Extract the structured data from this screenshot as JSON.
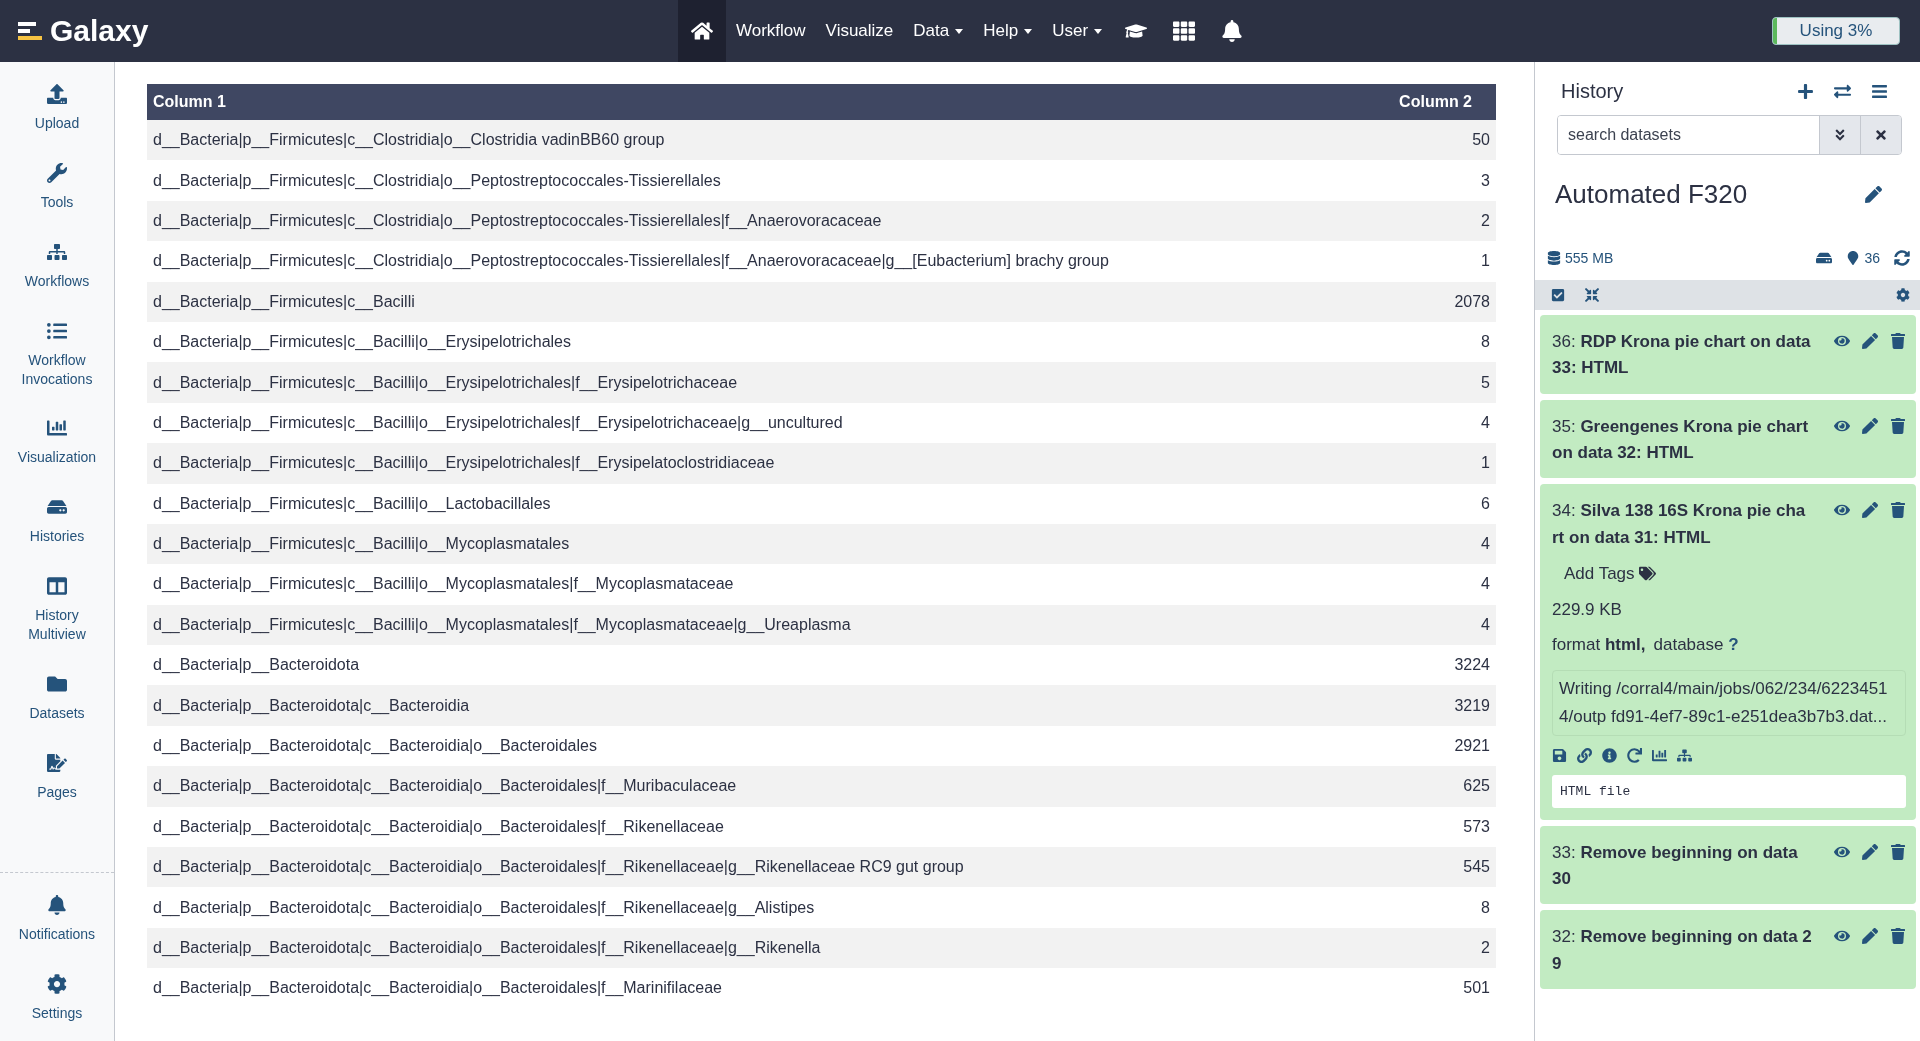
{
  "navbar": {
    "brand": "Galaxy",
    "items": [
      {
        "kind": "icon",
        "selected": true
      },
      {
        "kind": "link",
        "label": "Workflow",
        "selected": false
      },
      {
        "kind": "link",
        "label": "Visualize",
        "selected": false
      },
      {
        "kind": "dropdown",
        "label": "Data",
        "selected": false
      },
      {
        "kind": "dropdown",
        "label": "Help",
        "selected": false
      },
      {
        "kind": "dropdown",
        "label": "User",
        "selected": false
      },
      {
        "kind": "icon",
        "selected": false
      },
      {
        "kind": "icon",
        "selected": false
      },
      {
        "kind": "icon",
        "selected": false
      }
    ],
    "quota": {
      "label": "Using 3%",
      "level": 0.03
    }
  },
  "sidebar": {
    "items": [
      {
        "label": "Upload"
      },
      {
        "label": "Tools"
      },
      {
        "label": "Workflows"
      },
      {
        "label": "Workflow Invocations"
      },
      {
        "label": "Visualization"
      },
      {
        "label": "Histories"
      },
      {
        "label": "History Multiview"
      },
      {
        "label": "Datasets"
      },
      {
        "label": "Pages"
      }
    ],
    "bottom_items": [
      {
        "label": "Notifications"
      },
      {
        "label": "Settings"
      }
    ]
  },
  "table": {
    "columns": [
      "Column 1",
      "Column 2"
    ],
    "rows": [
      [
        "d__Bacteria|p__Firmicutes|c__Clostridia|o__Clostridia vadinBB60 group",
        "50"
      ],
      [
        "d__Bacteria|p__Firmicutes|c__Clostridia|o__Peptostreptococcales-Tissierellales",
        "3"
      ],
      [
        "d__Bacteria|p__Firmicutes|c__Clostridia|o__Peptostreptococcales-Tissierellales|f__Anaerovoracaceae",
        "2"
      ],
      [
        "d__Bacteria|p__Firmicutes|c__Clostridia|o__Peptostreptococcales-Tissierellales|f__Anaerovoracaceae|g__[Eubacterium] brachy group",
        "1"
      ],
      [
        "d__Bacteria|p__Firmicutes|c__Bacilli",
        "2078"
      ],
      [
        "d__Bacteria|p__Firmicutes|c__Bacilli|o__Erysipelotrichales",
        "8"
      ],
      [
        "d__Bacteria|p__Firmicutes|c__Bacilli|o__Erysipelotrichales|f__Erysipelotrichaceae",
        "5"
      ],
      [
        "d__Bacteria|p__Firmicutes|c__Bacilli|o__Erysipelotrichales|f__Erysipelotrichaceae|g__uncultured",
        "4"
      ],
      [
        "d__Bacteria|p__Firmicutes|c__Bacilli|o__Erysipelotrichales|f__Erysipelatoclostridiaceae",
        "1"
      ],
      [
        "d__Bacteria|p__Firmicutes|c__Bacilli|o__Lactobacillales",
        "6"
      ],
      [
        "d__Bacteria|p__Firmicutes|c__Bacilli|o__Mycoplasmatales",
        "4"
      ],
      [
        "d__Bacteria|p__Firmicutes|c__Bacilli|o__Mycoplasmatales|f__Mycoplasmataceae",
        "4"
      ],
      [
        "d__Bacteria|p__Firmicutes|c__Bacilli|o__Mycoplasmatales|f__Mycoplasmataceae|g__Ureaplasma",
        "4"
      ],
      [
        "d__Bacteria|p__Bacteroidota",
        "3224"
      ],
      [
        "d__Bacteria|p__Bacteroidota|c__Bacteroidia",
        "3219"
      ],
      [
        "d__Bacteria|p__Bacteroidota|c__Bacteroidia|o__Bacteroidales",
        "2921"
      ],
      [
        "d__Bacteria|p__Bacteroidota|c__Bacteroidia|o__Bacteroidales|f__Muribaculaceae",
        "625"
      ],
      [
        "d__Bacteria|p__Bacteroidota|c__Bacteroidia|o__Bacteroidales|f__Rikenellaceae",
        "573"
      ],
      [
        "d__Bacteria|p__Bacteroidota|c__Bacteroidia|o__Bacteroidales|f__Rikenellaceae|g__Rikenellaceae RC9 gut group",
        "545"
      ],
      [
        "d__Bacteria|p__Bacteroidota|c__Bacteroidia|o__Bacteroidales|f__Rikenellaceae|g__Alistipes",
        "8"
      ],
      [
        "d__Bacteria|p__Bacteroidota|c__Bacteroidia|o__Bacteroidales|f__Rikenellaceae|g__Rikenella",
        "2"
      ],
      [
        "d__Bacteria|p__Bacteroidota|c__Bacteroidia|o__Bacteroidales|f__Marinifilaceae",
        "501"
      ]
    ]
  },
  "history": {
    "title": "History",
    "search": {
      "placeholder": "search datasets"
    },
    "name": "Automated F320",
    "size": "555 MB",
    "count": "36",
    "datasets": [
      {
        "kind": "collapsed",
        "hid": "36:",
        "name": "RDP Krona pie chart on data 33: HTML"
      },
      {
        "kind": "collapsed",
        "hid": "35:",
        "name": "Greengenes Krona pie chart on data 32: HTML"
      },
      {
        "kind": "expanded",
        "hid": "34:",
        "name": "Silva 138 16S Krona pie cha rt on data 31: HTML",
        "tags": "Add Tags",
        "filesize": "229.9 KB",
        "format_label": "format",
        "format": "html,",
        "database_label": "database",
        "database": "?",
        "info": "Writing /corral4/main/jobs/062/234/62234514/outp fd91-4ef7-89c1-e251dea3b7b3.dat...",
        "peek": "HTML file"
      },
      {
        "kind": "collapsed",
        "hid": "33:",
        "name": "Remove beginning on data 30"
      },
      {
        "kind": "collapsed",
        "hid": "32:",
        "name": "Remove beginning on data 2 9"
      }
    ]
  }
}
